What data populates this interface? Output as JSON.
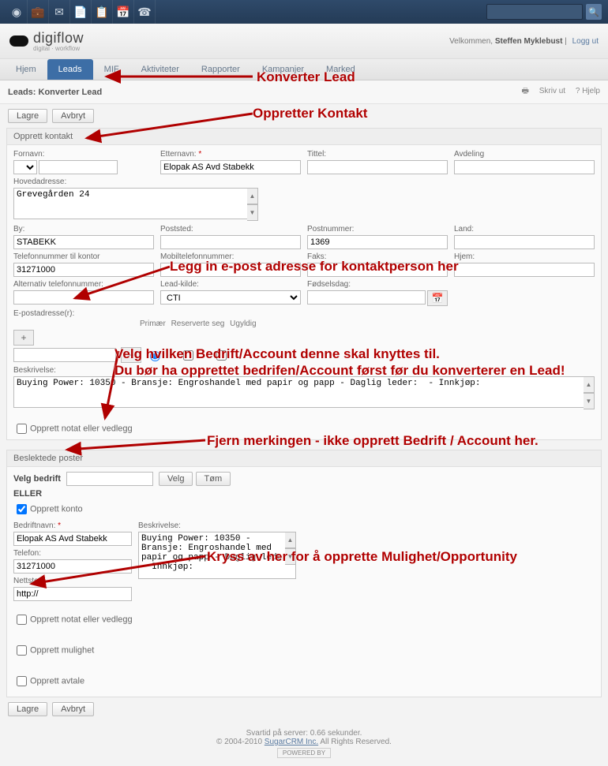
{
  "topbar": {
    "icons": [
      "cube-icon",
      "briefcase-icon",
      "mail-icon",
      "doc-icon",
      "list-icon",
      "calendar-icon",
      "phone-icon"
    ]
  },
  "header": {
    "brand": "digiflow",
    "brand_sub": "digital · workflow",
    "welcome_prefix": "Velkommen, ",
    "user": "Steffen Myklebust",
    "logout": "Logg ut"
  },
  "tabs": [
    "Hjem",
    "Leads",
    "MIF",
    "Aktiviteter",
    "Rapporter",
    "Kampanjer",
    "Marked"
  ],
  "tabs_active": 1,
  "subbar": {
    "title": "Leads: Konverter Lead",
    "print": "Skriv ut",
    "help": "? Hjelp"
  },
  "buttons": {
    "save": "Lagre",
    "cancel": "Avbryt"
  },
  "panel_contact": "Opprett kontakt",
  "contact": {
    "fornavn_l": "Fornavn:",
    "fornavn": "",
    "etternavn_l": "Etternavn:",
    "etternavn": "Elopak AS Avd Stabekk",
    "tittel_l": "Tittel:",
    "tittel": "",
    "avdeling_l": "Avdeling",
    "avdeling": "",
    "hoved_l": "Hovedadresse:",
    "hoved": "Grevegården 24",
    "by_l": "By:",
    "by": "STABEKK",
    "poststed_l": "Poststed:",
    "poststed": "",
    "postnr_l": "Postnummer:",
    "postnr": "1369",
    "land_l": "Land:",
    "land": "",
    "tlfk_l": "Telefonnummer til kontor",
    "tlfk": "31271000",
    "mob_l": "Mobiltelefonnummer:",
    "mob": "",
    "faks_l": "Faks:",
    "faks": "",
    "hjem_l": "Hjem:",
    "hjem": "",
    "alt_l": "Alternativ telefonnummer:",
    "alt": "",
    "kilde_l": "Lead-kilde:",
    "kilde": "CTI",
    "fodt_l": "Fødselsdag:",
    "fodt": "",
    "epost_l": "E-postadresse(r):",
    "epost": "",
    "epost_cols": {
      "a": "Primær",
      "b": "Reserverte seg",
      "c": "Ugyldig"
    },
    "beskr_l": "Beskrivelse:",
    "beskr": "Buying Power: 10350 - Bransje: Engroshandel med papir og papp - Daglig leder:  - Innkjøp:",
    "notat": "Opprett notat eller vedlegg"
  },
  "panel_related": "Beslektede poster",
  "related": {
    "velg_l": "Velg bedrift",
    "velg": "",
    "velg_btn": "Velg",
    "tom_btn": "Tøm",
    "eller": "ELLER",
    "opprett_konto": "Opprett konto",
    "opprett_konto_checked": true,
    "bn_l": "Bedriftnavn:",
    "bn": "Elopak AS Avd Stabekk",
    "tel_l": "Telefon:",
    "tel": "31271000",
    "net_l": "Nettsted:",
    "net": "http://",
    "bes_l": "Beskrivelse:",
    "bes": "Buying Power: 10350 - Bransje: Engroshandel med papir og papp - Daglig leder:  - Innkjøp:",
    "notat": "Opprett notat eller vedlegg",
    "mulighet": "Opprett mulighet",
    "avtale": "Opprett avtale"
  },
  "footer": {
    "line1": "Svartid på server: 0.66 sekunder.",
    "line2a": "© 2004-2010 ",
    "line2b": "SugarCRM Inc.",
    "line2c": " All Rights Reserved.",
    "powered": "POWERED BY"
  },
  "annotations": {
    "a1": "Konverter Lead",
    "a2": "Oppretter Kontakt",
    "a3": "Legg in e-post adresse for kontaktperson her",
    "a4": "Velg hvilken Bedrift/Account denne skal knyttes til.",
    "a4b": "Du bør ha opprettet bedrifen/Account først før du konverterer en Lead!",
    "a5": "Fjern merkingen - ikke opprett Bedrift / Account her.",
    "a6": "Kryss av her for å opprette Mulighet/Opportunity"
  }
}
